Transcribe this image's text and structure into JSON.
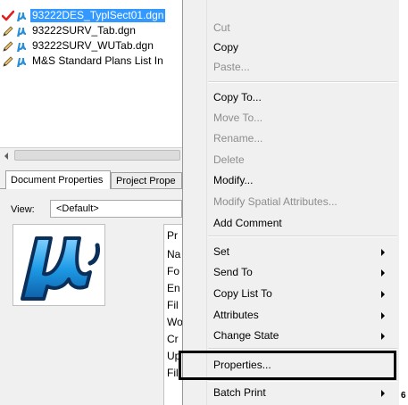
{
  "files": [
    {
      "name": "93222DES_TyplSect01.dgn",
      "status_icon": "checkmark-icon",
      "selected": true
    },
    {
      "name": "93222SURV_Tab.dgn",
      "status_icon": "pencil-icon",
      "selected": false
    },
    {
      "name": "93222SURV_WUTab.dgn",
      "status_icon": "pencil-icon",
      "selected": false
    },
    {
      "name": "M&S Standard Plans List In",
      "status_icon": "pencil-icon",
      "selected": false
    }
  ],
  "tabs": [
    {
      "label": "Document Properties",
      "active": true
    },
    {
      "label": "Project Prope",
      "active": false
    }
  ],
  "view": {
    "label": "View:",
    "selected": "<Default>"
  },
  "property_labels": [
    "Pr",
    "Na",
    "Fo",
    "En",
    "Fil",
    "Wo",
    "Cr",
    "Up",
    "Fil"
  ],
  "menu": {
    "items": [
      {
        "label": "Cut",
        "enabled": false
      },
      {
        "label": "Copy",
        "enabled": true
      },
      {
        "label": "Paste...",
        "enabled": false
      },
      {
        "label": "Copy To...",
        "enabled": true
      },
      {
        "label": "Move To...",
        "enabled": false
      },
      {
        "label": "Rename...",
        "enabled": false
      },
      {
        "label": "Delete",
        "enabled": false
      },
      {
        "label": "Modify...",
        "enabled": true
      },
      {
        "label": "Modify Spatial Attributes...",
        "enabled": false
      },
      {
        "label": "Add Comment",
        "enabled": true
      },
      {
        "label": "Set",
        "enabled": true,
        "submenu": true
      },
      {
        "label": "Send To",
        "enabled": true,
        "submenu": true
      },
      {
        "label": "Copy List To",
        "enabled": true,
        "submenu": true
      },
      {
        "label": "Attributes",
        "enabled": true,
        "submenu": true
      },
      {
        "label": "Change State",
        "enabled": true,
        "submenu": true
      },
      {
        "label": "Properties...",
        "enabled": true,
        "highlighted": true
      },
      {
        "label": "Batch Print",
        "enabled": true,
        "submenu": true
      }
    ]
  },
  "edge_digit": "6",
  "colors": {
    "selection": "#3399ff",
    "check": "#e02020",
    "microstation": "#2a8fd8",
    "menu_bg": "#f0f0f0"
  }
}
